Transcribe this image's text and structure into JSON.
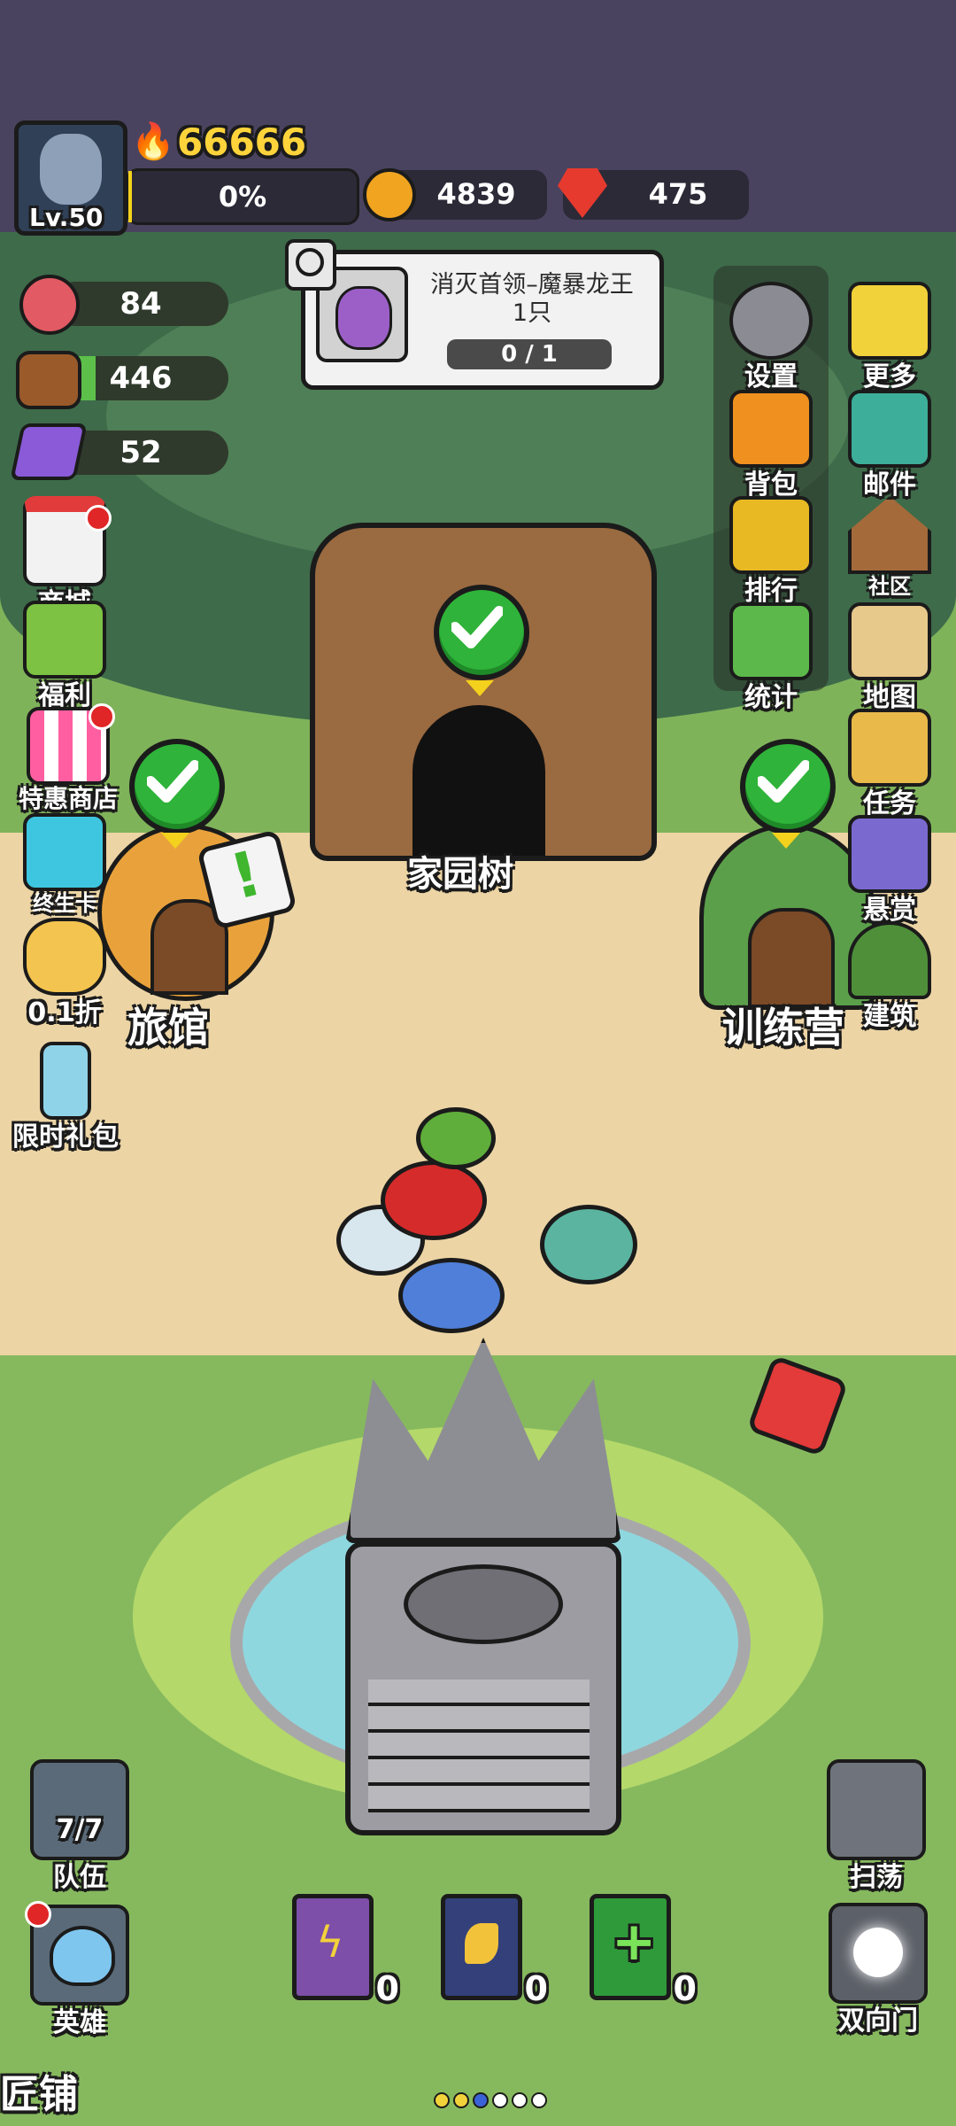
{
  "player": {
    "level": "Lv.50",
    "power": "66666",
    "exp_percent": "0%"
  },
  "currency": {
    "gold": "4839",
    "gems": "475"
  },
  "resources": {
    "meat": "84",
    "wood": "446",
    "crystal": "52"
  },
  "quest": {
    "title": "消灭首领–魔暴龙王",
    "count": "1只",
    "progress": "0 / 1"
  },
  "right_menu": {
    "settings": "设置",
    "more": "更多",
    "backpack": "背包",
    "mail": "邮件",
    "ranking": "排行",
    "community": "社区",
    "stats": "统计",
    "map": "地图",
    "tasks": "任务",
    "bounty": "悬赏",
    "build": "建筑"
  },
  "left_menu": {
    "shop": "商城",
    "welfare": "福利",
    "special_shop": "特惠商店",
    "lifetime_card": "终生卡",
    "discount": "0.1折",
    "limited_pack": "限时礼包"
  },
  "buildings": {
    "home_tree": "家园树",
    "inn": "旅馆",
    "training_camp": "训练营",
    "smithy": "匠铺"
  },
  "bottom": {
    "team_count": "7/7",
    "team": "队伍",
    "hero": "英雄",
    "sweep": "扫荡",
    "portal": "双向门"
  },
  "books": [
    {
      "count": "0"
    },
    {
      "count": "0"
    },
    {
      "count": "0"
    }
  ],
  "colors": {
    "topbar": "#4a435f",
    "grass": "#7fb35a",
    "path": "#ecd4a4",
    "canopy": "#3e6b4a"
  }
}
